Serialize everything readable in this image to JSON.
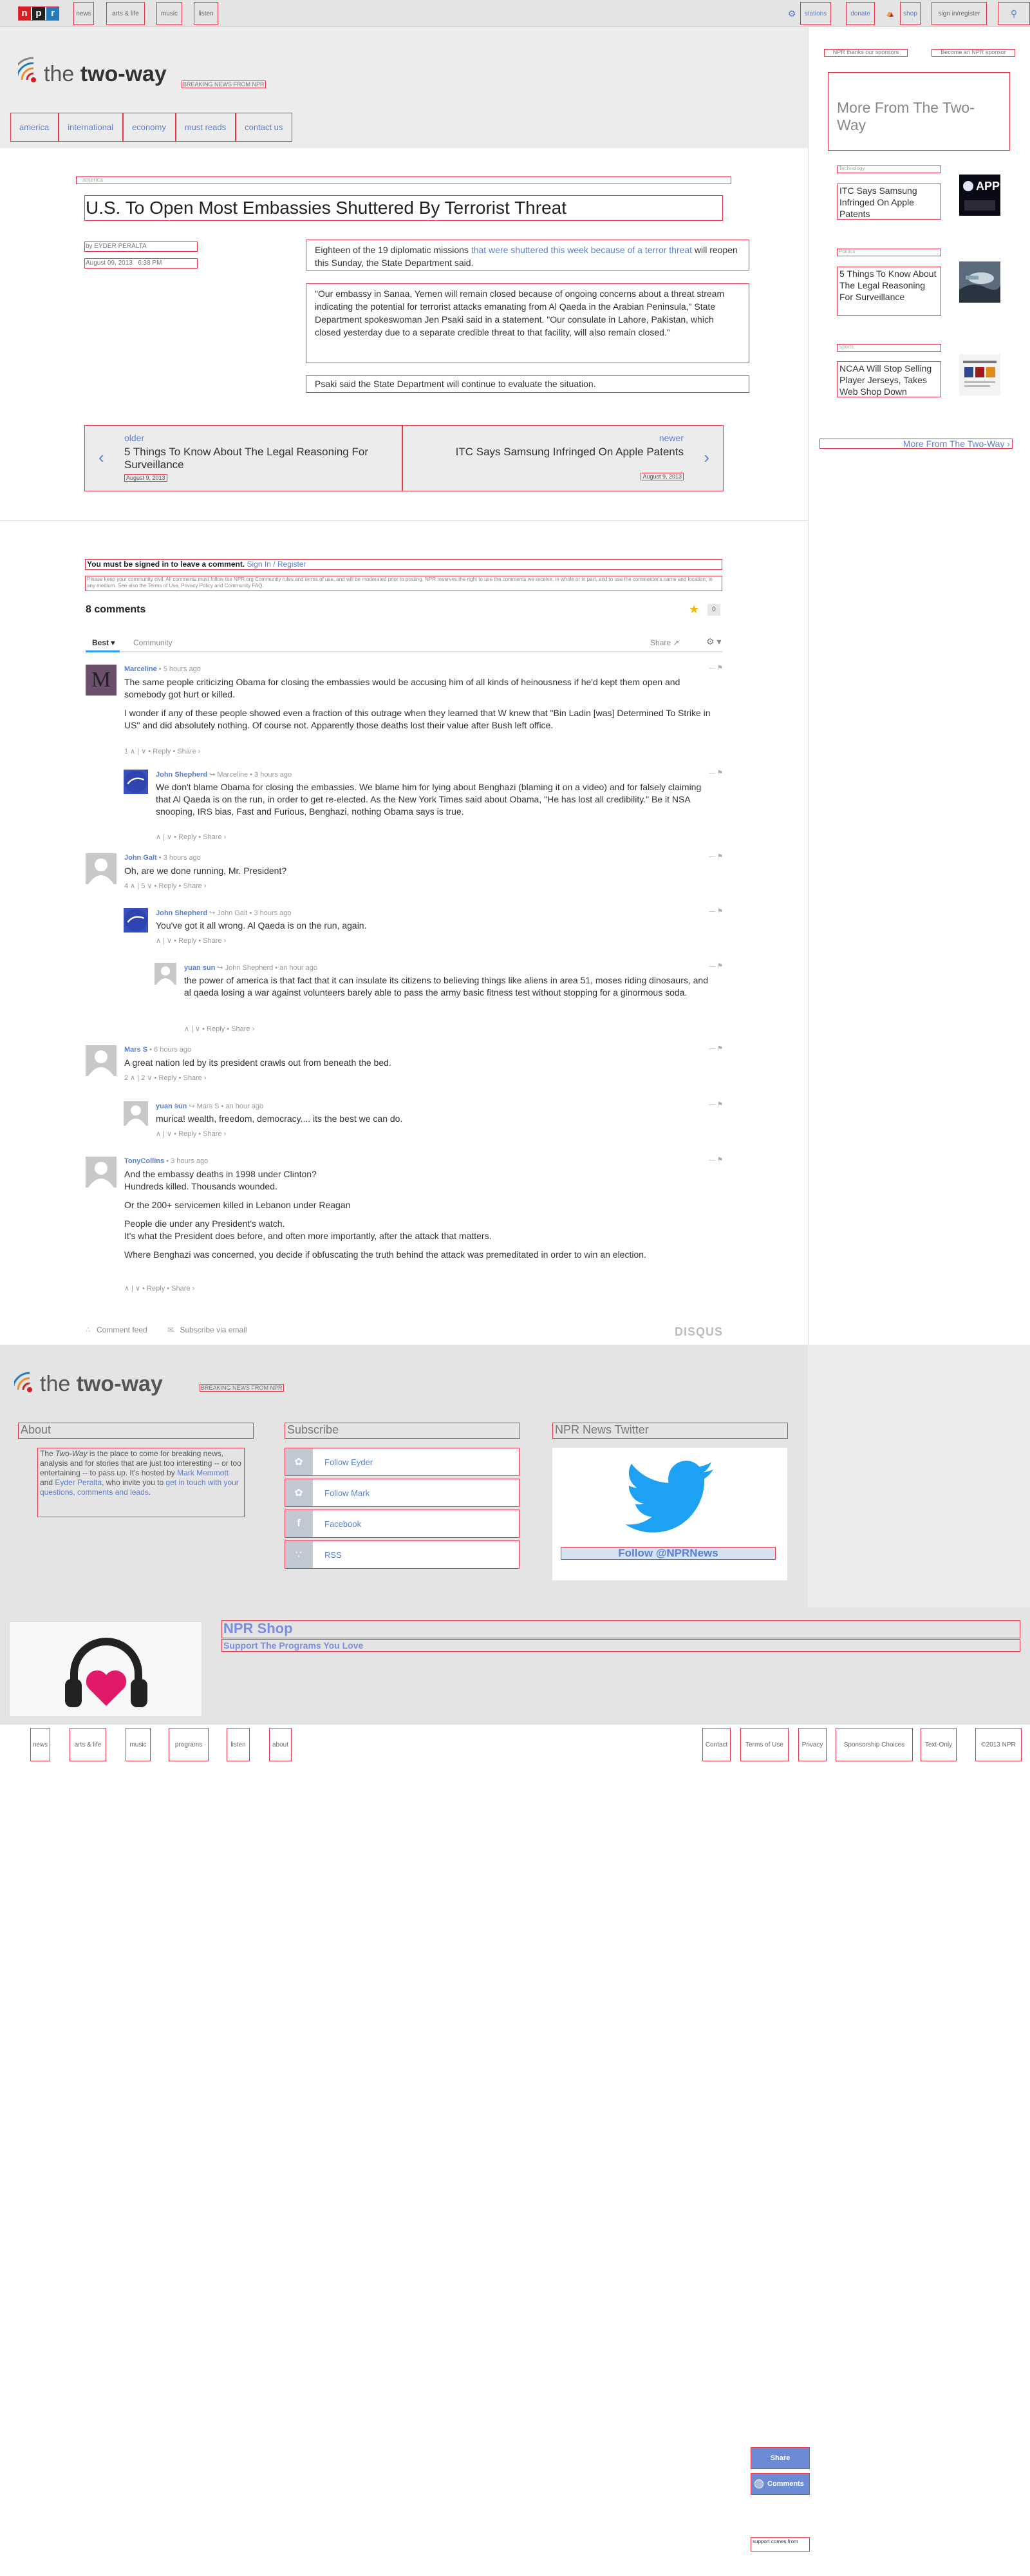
{
  "top_nav": {
    "logo_letters": [
      "n",
      "p",
      "r"
    ],
    "left_items": [
      "news",
      "arts & life",
      "music",
      "listen"
    ],
    "right_items": [
      "stations",
      "donate",
      "shop",
      "sign in/register"
    ],
    "search_icon": "search-icon",
    "right_mic_icon": "station-icon"
  },
  "blog": {
    "name_light": "the ",
    "name_bold": "two-way",
    "tagline": "BREAKING NEWS FROM NPR",
    "sections": [
      "america",
      "international",
      "economy",
      "must reads",
      "contact us"
    ]
  },
  "article": {
    "kicker": "america",
    "headline": "U.S. To Open Most Embassies Shuttered By Terrorist Threat",
    "byline": "by EYDER PERALTA",
    "date": "August 09, 2013",
    "time": "6:38 PM",
    "p1_a": "Eighteen of the 19 diplomatic missions ",
    "p1_link": "that were shuttered this week because of a terror threat",
    "p1_b": " will reopen this Sunday, the State Department said.",
    "p2": "\"Our embassy in Sanaa, Yemen will remain closed because of ongoing concerns about a threat stream indicating the potential for terrorist attacks emanating from Al Qaeda in the Arabian Peninsula,\" State Department spokeswoman Jen Psaki said in a statement. \"Our consulate in Lahore, Pakistan, which closed yesterday due to a separate credible threat to that facility, will also remain closed.\"",
    "p3": "Psaki said the State Department will continue to evaluate the situation."
  },
  "prev_next": {
    "older_label": "older",
    "older_title": "5 Things To Know About The Legal Reasoning For Surveillance",
    "older_date": "August 9, 2013",
    "newer_label": "newer",
    "newer_title": "ITC Says Samsung Infringed On Apple Patents",
    "newer_date": "August 9, 2013"
  },
  "sidebar": {
    "link1": "NPR thanks our sponsors",
    "link2": "Become an NPR sponsor",
    "more_heading": "More From The Two-Way",
    "items": [
      {
        "kicker": "Technology",
        "title": "ITC Says Samsung Infringed On Apple Patents"
      },
      {
        "kicker": "Politics",
        "title": "5 Things To Know About The Legal Reasoning For Surveillance"
      },
      {
        "kicker": "Sports",
        "title": "NCAA Will Stop Selling Player Jerseys, Takes Web Shop Down"
      }
    ],
    "more_link": "More From The Two-Way ›"
  },
  "comments": {
    "signin_bold": "You must be signed in to leave a comment.",
    "signin_link": "Sign In / Register",
    "policy": "Please keep your community civil. All comments must follow the NPR.org Community rules and terms of use, and will be moderated prior to posting. NPR reserves the right to use the comments we receive, in whole or in part, and to use the commenter's name and location, in any medium. See also the Terms of Use, Privacy Policy and Community FAQ.",
    "count": "8 comments",
    "star_count": "0",
    "tab_best": "Best",
    "tab_community": "Community",
    "share": "Share",
    "list": [
      {
        "author": "Marceline",
        "reply_to": "",
        "time": "5 hours ago",
        "body": "The same people criticizing Obama for closing the embassies would be accusing him of all kinds of heinousness if he'd kept them open and somebody got hurt or killed.\n\nI wonder if any of these people showed even a fraction of this outrage when they learned that W knew that \"Bin Ladin [was] Determined To Strike in US\" and did absolutely nothing. Of course not. Apparently those deaths lost their value after Bush left office.",
        "up": "1",
        "down": "",
        "reply": "Reply"
      },
      {
        "author": "John Shepherd",
        "reply_to": "Marceline",
        "time": "3 hours ago",
        "body": "We don't blame Obama for closing the embassies. We blame him for lying about Benghazi (blaming it on a video) and for falsely claiming that Al Qaeda is on the run, in order to get re-elected. As the New York Times said about Obama, \"He has lost all credibility.\" Be it NSA snooping, IRS bias, Fast and Furious, Benghazi, nothing Obama says is true.",
        "up": "",
        "down": "",
        "reply": "Reply"
      },
      {
        "author": "John Galt",
        "reply_to": "",
        "time": "3 hours ago",
        "body": "Oh, are we done running, Mr. President?",
        "up": "4",
        "down": "5",
        "reply": "Reply"
      },
      {
        "author": "John Shepherd",
        "reply_to": "John Galt",
        "time": "3 hours ago",
        "body": "You've got it all wrong. Al Qaeda is on the run, again.",
        "up": "",
        "down": "",
        "reply": "Reply"
      },
      {
        "author": "yuan sun",
        "reply_to": "John Shepherd",
        "time": "an hour ago",
        "body": "the power of america is that fact that it can insulate its citizens to believing things like aliens in area 51, moses riding dinosaurs, and al qaeda losing a war against volunteers barely able to pass the army basic fitness test without stopping for a ginormous soda.",
        "up": "",
        "down": "",
        "reply": "Reply"
      },
      {
        "author": "Mars S",
        "reply_to": "",
        "time": "6 hours ago",
        "body": "A great nation led by its president crawls out from beneath the bed.",
        "up": "2",
        "down": "2",
        "reply": "Reply"
      },
      {
        "author": "yuan sun",
        "reply_to": "Mars S",
        "time": "an hour ago",
        "body": "murica! wealth, freedom, democracy.... its the best we can do.",
        "up": "",
        "down": "",
        "reply": "Reply"
      },
      {
        "author": "TonyCollins",
        "reply_to": "",
        "time": "3 hours ago",
        "body": "And the embassy deaths in 1998 under Clinton?\nHundreds killed. Thousands wounded.\n\nOr the 200+ servicemen killed in Lebanon under Reagan\n\nPeople die under any President's watch.\nIt's what the President does before, and often more importantly, after the attack that matters.\n\nWhere Benghazi was concerned, you decide if obfuscating the truth behind the attack was premeditated in order to win an election.",
        "up": "",
        "down": "",
        "reply": "Reply"
      }
    ],
    "feed": "Comment feed",
    "subscribe": "Subscribe via email",
    "disqus": "DISQUS"
  },
  "footer": {
    "about_head": "About",
    "subscribe_head": "Subscribe",
    "twitter_head": "NPR News Twitter",
    "about_a": "The ",
    "about_em": "Two-Way",
    "about_b": " is the place to come for breaking news, analysis and for stories that are just too interesting -- or too entertaining -- to pass up. It's hosted by ",
    "about_link1": "Mark Memmott",
    "about_c": " and ",
    "about_link2": "Eyder Peralta",
    "about_d": ", who invite you to ",
    "about_link3": "get in touch with your questions, comments and leads",
    "about_e": ".",
    "subscribe_items": [
      {
        "icon": "twitter-icon",
        "label": "Follow Eyder"
      },
      {
        "icon": "twitter-icon",
        "label": "Follow Mark"
      },
      {
        "icon": "facebook-icon",
        "label": "Facebook"
      },
      {
        "icon": "rss-icon",
        "label": "RSS"
      }
    ],
    "twitter_button": "Follow @NPRNews",
    "shop_title": "NPR Shop",
    "shop_sub": "Support The Programs You Love"
  },
  "bottom_nav": {
    "left": [
      "news",
      "arts & life",
      "music",
      "programs",
      "listen",
      "about"
    ],
    "right": [
      "Contact",
      "Terms of Use",
      "Privacy",
      "Sponsorship Choices",
      "Text-Only",
      "©2013 NPR"
    ]
  },
  "floating": {
    "share": "Share",
    "comments": "Comments",
    "support": "support comes from"
  },
  "colors": {
    "accent": "#5a7fcf",
    "npr_red": "#d62021",
    "npr_black": "#222",
    "npr_blue": "#237bbd"
  }
}
